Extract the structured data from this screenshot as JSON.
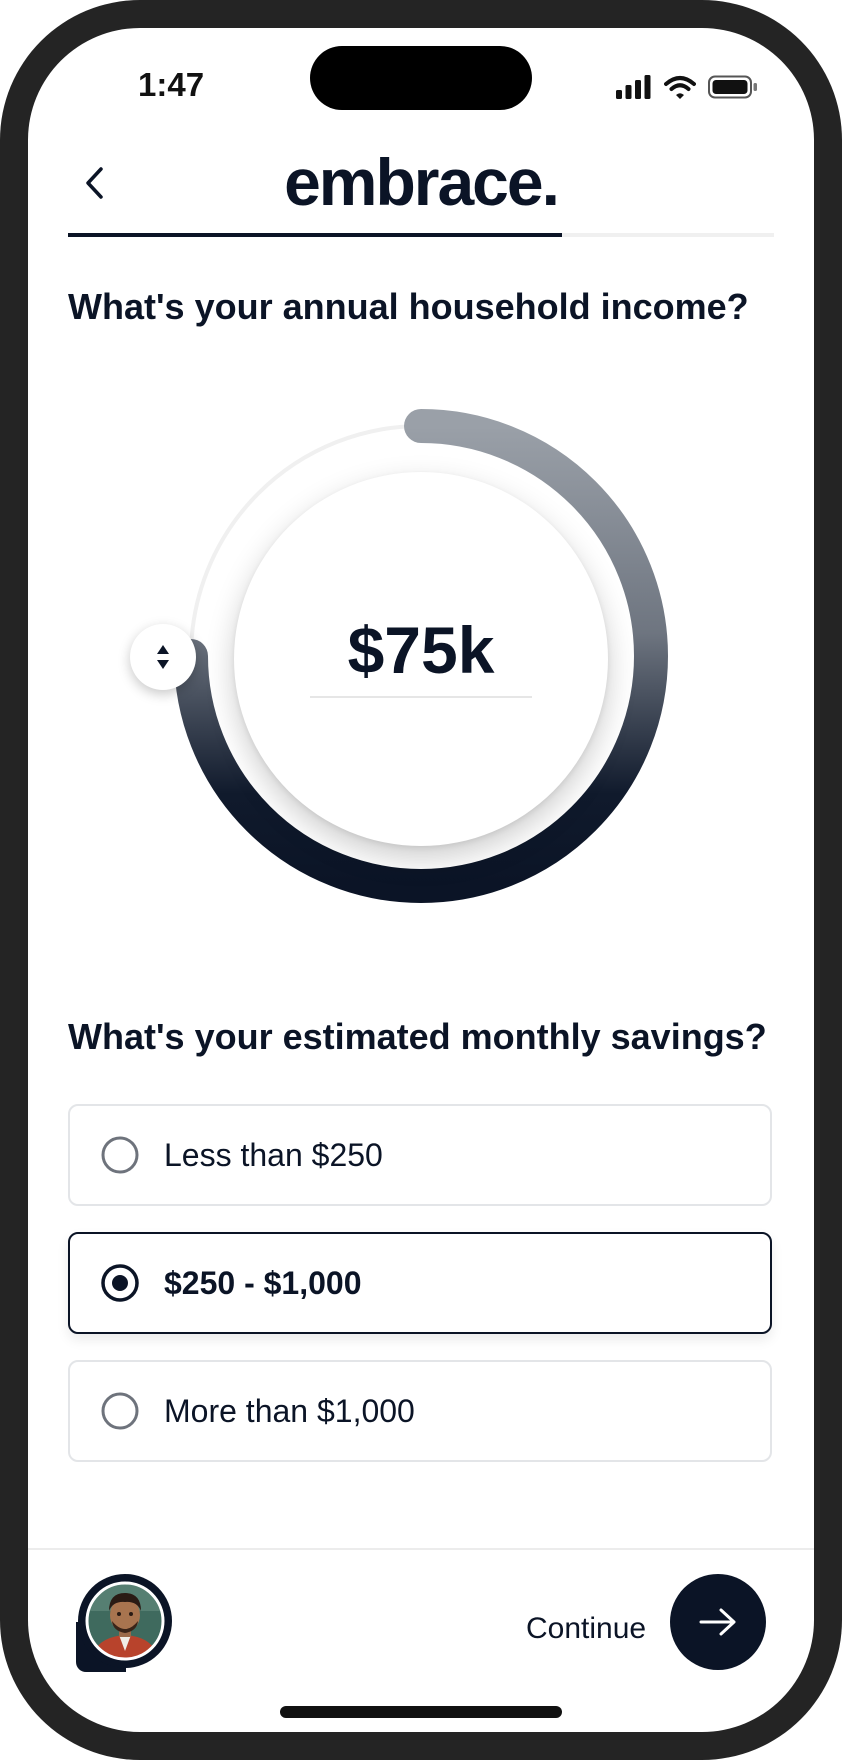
{
  "status_bar": {
    "time": "1:47"
  },
  "header": {
    "logo": "embrace.",
    "progress": 0.7
  },
  "income": {
    "question": "What's your annual household income?",
    "value_label": "$75k",
    "slider_fraction": 0.75
  },
  "savings": {
    "question": "What's your estimated monthly savings?",
    "options": [
      {
        "label": "Less than $250",
        "selected": false
      },
      {
        "label": "$250 - $1,000",
        "selected": true
      },
      {
        "label": "More than $1,000",
        "selected": false
      }
    ]
  },
  "footer": {
    "continue_label": "Continue"
  },
  "icons": {
    "back": "chevron-left-icon",
    "knob": "up-down-arrows-icon",
    "continue": "arrow-right-icon",
    "signal": "cellular-signal-icon",
    "wifi": "wifi-icon",
    "battery": "battery-icon"
  },
  "colors": {
    "primary": "#0b1426",
    "track": "#f0f0f0",
    "arc_start": "#9aa0a8"
  }
}
